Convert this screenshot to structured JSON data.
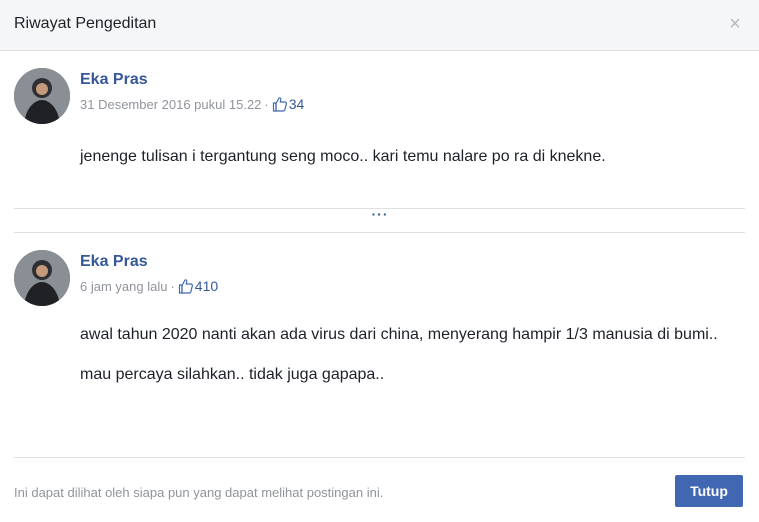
{
  "dialog": {
    "title": "Riwayat Pengeditan",
    "close_icon": "×"
  },
  "entries": [
    {
      "author": "Eka Pras",
      "timestamp": "31 Desember 2016 pukul 15.22",
      "separator": "·",
      "like_count": "34",
      "paragraphs": [
        "jenenge tulisan i tergantung seng moco.. kari temu nalare po ra di knekne."
      ]
    },
    {
      "author": "Eka Pras",
      "timestamp": "6 jam yang lalu",
      "separator": "·",
      "like_count": "410",
      "paragraphs": [
        "awal tahun 2020 nanti akan ada virus dari china, menyerang hampir 1/3 manusia di bumi..",
        "mau percaya silahkan.. tidak juga gapapa.."
      ]
    }
  ],
  "more_label": "···",
  "footer": {
    "note": "Ini dapat dilihat oleh siapa pun yang dapat melihat postingan ini.",
    "close_label": "Tutup"
  },
  "colors": {
    "link": "#365899",
    "primary_button": "#4267b2",
    "muted_text": "#90949c"
  }
}
